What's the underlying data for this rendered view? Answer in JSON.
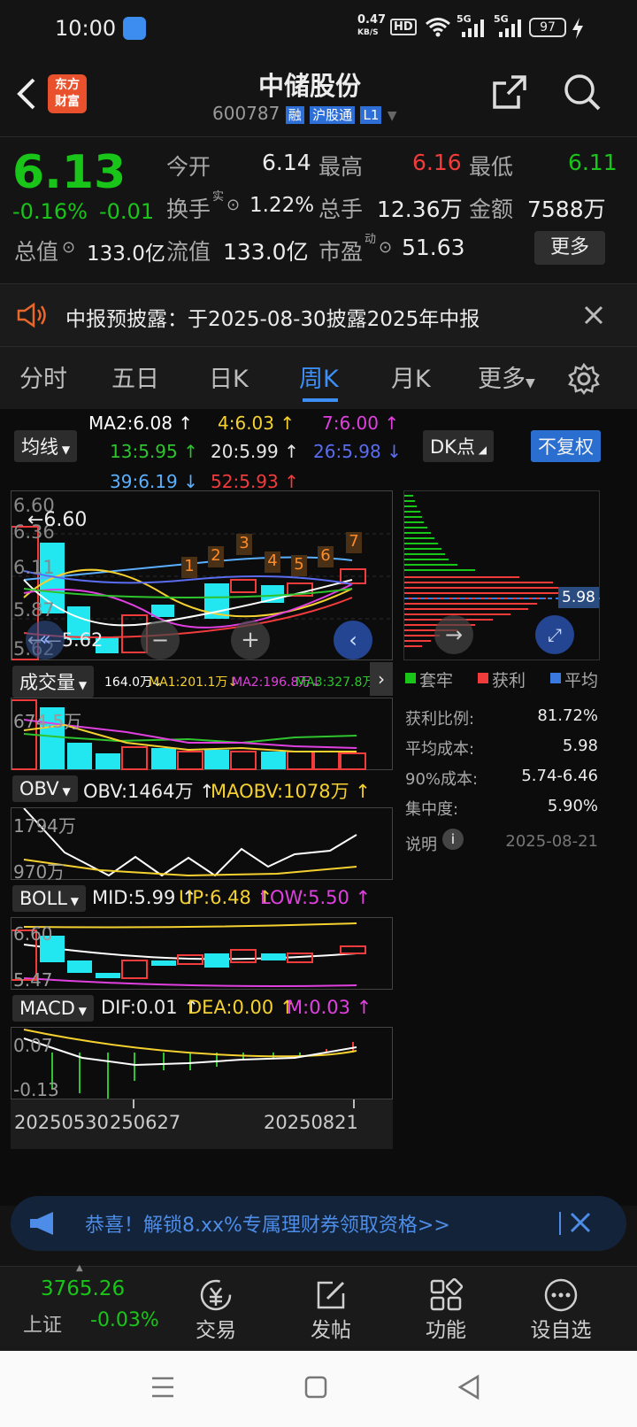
{
  "status": {
    "time": "10:00",
    "net_speed_value": "0.47",
    "net_speed_unit": "KB/S",
    "hd": "HD",
    "sig1": "5G",
    "sig2": "5G",
    "battery": "97"
  },
  "header": {
    "logo_line1": "东方",
    "logo_line2": "财富",
    "title": "中储股份",
    "code": "600787",
    "tag_rong": "融",
    "tag_hgt": "沪股通",
    "tag_l1": "L1"
  },
  "quote": {
    "price": "6.13",
    "change_pct": "-0.16%",
    "change": "-0.01",
    "open_label": "今开",
    "open": "6.14",
    "high_label": "最高",
    "high": "6.16",
    "low_label": "最低",
    "low": "6.11",
    "turnover_label": "换手",
    "turnover_sup": "实",
    "turnover": "1.22%",
    "vol_label": "总手",
    "vol": "12.36万",
    "amount_label": "金额",
    "amount": "7588万",
    "mktcap_label": "总值",
    "mktcap": "133.0亿",
    "float_label": "流值",
    "float": "133.0亿",
    "pe_label": "市盈",
    "pe_sup": "动",
    "pe": "51.63",
    "more_btn": "更多"
  },
  "notice": {
    "text": "中报预披露：于2025-08-30披露2025年中报"
  },
  "tabs": [
    "分时",
    "五日",
    "日K",
    "周K",
    "月K",
    "更多"
  ],
  "kline": {
    "ma_btn": "均线",
    "dk_btn": "DK点",
    "fq_btn": "不复权",
    "ma": [
      {
        "t": "MA2:6.08",
        "a": "↑",
        "c": "#ffffff"
      },
      {
        "t": "4:6.03",
        "a": "↑",
        "c": "#f5d130"
      },
      {
        "t": "7:6.00",
        "a": "↑",
        "c": "#e040e0"
      },
      {
        "t": "13:5.95",
        "a": "↑",
        "c": "#2ec42e"
      },
      {
        "t": "20:5.99",
        "a": "↑",
        "c": "#e6e6e6"
      },
      {
        "t": "26:5.98",
        "a": "↓",
        "c": "#5a6cf0"
      },
      {
        "t": "39:6.19",
        "a": "↓",
        "c": "#5ab0ff"
      },
      {
        "t": "52:5.93",
        "a": "↑",
        "c": "#f23b3b"
      }
    ],
    "y_top": "6.60",
    "y_mid1": "6.36",
    "y_mid2": "6.11",
    "y_mid3": "5.87",
    "y_bottom": "5.62",
    "max_label": "←6.60",
    "min_label": "←—5.62",
    "markers": [
      "1",
      "2",
      "3",
      "4",
      "5",
      "6",
      "7"
    ]
  },
  "chips": {
    "price_label": "5.98",
    "legend": [
      {
        "t": "套牢",
        "c": "#19c519"
      },
      {
        "t": "获利",
        "c": "#f23b3b"
      },
      {
        "t": "平均",
        "c": "#3a7ae0"
      }
    ],
    "rows": [
      {
        "k": "获利比例:",
        "v": "81.72%"
      },
      {
        "k": "平均成本:",
        "v": "5.98"
      },
      {
        "k": "90%成本:",
        "v": "5.74-6.46"
      },
      {
        "k": "集中度:",
        "v": "5.90%"
      }
    ],
    "explain": "说明",
    "date": "2025-08-21"
  },
  "volume": {
    "btn": "成交量",
    "vals": [
      {
        "t": "164.0万↓",
        "c": "#ffffff"
      },
      {
        "t": "MA1:201.1万↓",
        "c": "#f5d130"
      },
      {
        "t": "MA2:196.8万↓",
        "c": "#e040e0"
      },
      {
        "t": "MA3:327.8万↑",
        "c": "#2ec42e"
      }
    ],
    "y_top": "674.5万"
  },
  "obv": {
    "btn": "OBV",
    "v1": "OBV:1464万 ↑",
    "v2": "MAOBV:1078万 ↑",
    "y_top": "1794万",
    "y_bottom": "970万"
  },
  "boll": {
    "btn": "BOLL",
    "mid": "MID:5.99 ↑",
    "up": "UP:6.48 ↑",
    "low": "LOW:5.50 ↑",
    "y_top": "6.60",
    "y_bottom": "5.47"
  },
  "macd": {
    "btn": "MACD",
    "dif": "DIF:0.01 ↑",
    "dea": "DEA:0.00 ↑",
    "m": "M:0.03 ↑",
    "y_top": "0.07",
    "y_bottom": "-0.13"
  },
  "xaxis": {
    "d1": "20250530",
    "d2": "250627",
    "d3": "20250821"
  },
  "ad": {
    "text": "恭喜！解锁8.xx%专属理财券领取资格>>"
  },
  "bottom": {
    "index_value": "3765.26",
    "index_name": "上证",
    "index_change": "-0.03%",
    "nav": [
      "交易",
      "发帖",
      "功能",
      "设自选"
    ]
  }
}
